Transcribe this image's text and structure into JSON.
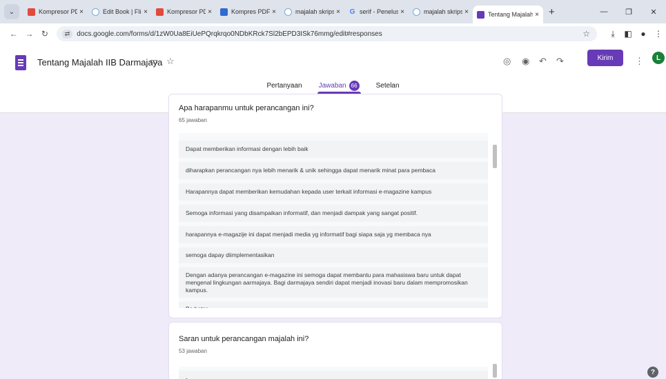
{
  "browser": {
    "tabs": [
      {
        "title": "Kompresor PDF",
        "favicon": "pdf-icon"
      },
      {
        "title": "Edit Book | Flipht",
        "favicon": "flipbook-icon"
      },
      {
        "title": "Kompresor PDF",
        "favicon": "pdf-icon"
      },
      {
        "title": "Kompres PDF ke",
        "favicon": "compress-icon"
      },
      {
        "title": "majalah skripsi",
        "favicon": "flipbook-icon"
      },
      {
        "title": "serif - Penelusur",
        "favicon": "google-icon"
      },
      {
        "title": "majalah skripsi",
        "favicon": "flipbook-icon"
      },
      {
        "title": "Tentang Majalah",
        "favicon": "forms-icon"
      }
    ],
    "close_glyph": "×",
    "url": "docs.google.com/forms/d/1zW0Ua8EiUePQrqkrqo0NDbKRck7Sl2bEPD3ISk76mmg/edit#responses"
  },
  "form": {
    "title": "Tentang Majalah IIB Darmajaya",
    "send_label": "Kirim",
    "avatar_initial": "L",
    "tabs": {
      "questions": "Pertanyaan",
      "responses": "Jawaban",
      "responses_count": "66",
      "settings": "Setelan"
    }
  },
  "cards": [
    {
      "question": "Apa harapanmu untuk perancangan ini?",
      "count_label": "65 jawaban",
      "answers": [
        "Dapat memberikan informasi dengan lebih baik",
        "diharapkan perancangan nya lebih menarik & unik sehingga dapat menarik minat para pembaca",
        "Harapannya dapat memberikan kemudahan kepada user terkait informasi e-magazine kampus",
        "Semoga informasi yang disampaikan informatif, dan menjadi dampak yang sangat positif.",
        "harapannya e-magazije ini dapat menjadi media yg informatif bagi siapa saja yg membaca nya",
        "semoga dapay diimplementasikan",
        "Dengan adanya perancangan e-magazine ini semoga dapat membantu para mahasiswa baru untuk dapat mengenal lingkungan aarmajaya. Bagi darmajaya sendiri dapat menjadi inovasi baru dalam mempromosikan kampus.",
        "Be beter"
      ]
    },
    {
      "question": "Saran untuk perancangan majalah ini?",
      "count_label": "53 jawaban",
      "answers": [
        "-"
      ]
    }
  ],
  "colors": {
    "accent": "#673ab7",
    "page_bg": "#f0ebf8",
    "avatar": "#188038"
  }
}
